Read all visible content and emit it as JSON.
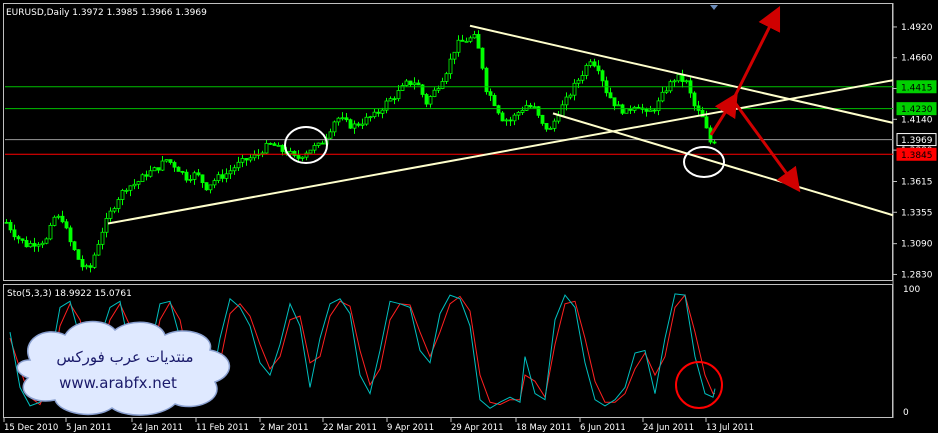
{
  "colors": {
    "background": "#000000",
    "frame": "#c0c0c0",
    "bull_candle": "#00ff00",
    "bear_candle": "#00ff00",
    "trendline": "#ffffcc",
    "hline_green": "#00c000",
    "hline_red": "#ff0000",
    "hline_gray": "#9a9a9a",
    "stoch_main": "#00c0c0",
    "stoch_signal": "#ff2020",
    "arrow": "#d00000",
    "circle_white": "#ffffff",
    "circle_red": "#ff0000",
    "badge_green": "#00d000",
    "badge_red": "#ff0000",
    "watermark_cloud": "#dfe9ff",
    "watermark_text": "#1a1a6a"
  },
  "chart_data": [
    {
      "type": "candlestick",
      "title": "EURUSD,Daily  1.3972 1.3985 1.3966 1.3969",
      "symbol": "EURUSD",
      "timeframe": "Daily",
      "ohlc_label": "1.3972 1.3985 1.3966 1.3969",
      "ylim": [
        1.28,
        1.508
      ],
      "y_ticks": [
        "1.4920",
        "1.4660",
        "1.4400",
        "1.4140",
        "1.3880",
        "1.3615",
        "1.3355",
        "1.3090",
        "1.2830"
      ],
      "y_tick_values": [
        1.492,
        1.466,
        1.44,
        1.414,
        1.388,
        1.3615,
        1.3355,
        1.309,
        1.283
      ],
      "price_badges": [
        {
          "label": "1.4415",
          "value": 1.4415,
          "kind": "green"
        },
        {
          "label": "1.4230",
          "value": 1.423,
          "kind": "green"
        },
        {
          "label": "1.3969",
          "value": 1.3969,
          "kind": "current"
        },
        {
          "label": "1.3845",
          "value": 1.3845,
          "kind": "red"
        }
      ],
      "x_ticks": [
        "15 Dec 2010",
        "5 Jan 2011",
        "24 Jan 2011",
        "11 Feb 2011",
        "2 Mar 2011",
        "22 Mar 2011",
        "9 Apr 2011",
        "29 Apr 2011",
        "18 May 2011",
        "6 Jun 2011",
        "24 Jun 2011",
        "13 Jul 2011"
      ],
      "close_path": [
        [
          0,
          1.327
        ],
        [
          10,
          1.315
        ],
        [
          20,
          1.308
        ],
        [
          30,
          1.31
        ],
        [
          40,
          1.312
        ],
        [
          48,
          1.331
        ],
        [
          56,
          1.33
        ],
        [
          64,
          1.31
        ],
        [
          72,
          1.296
        ],
        [
          78,
          1.287
        ],
        [
          84,
          1.289
        ],
        [
          90,
          1.305
        ],
        [
          96,
          1.32
        ],
        [
          104,
          1.335
        ],
        [
          112,
          1.348
        ],
        [
          120,
          1.357
        ],
        [
          130,
          1.36
        ],
        [
          140,
          1.368
        ],
        [
          150,
          1.372
        ],
        [
          160,
          1.38
        ],
        [
          170,
          1.374
        ],
        [
          180,
          1.365
        ],
        [
          190,
          1.368
        ],
        [
          200,
          1.357
        ],
        [
          210,
          1.364
        ],
        [
          220,
          1.368
        ],
        [
          230,
          1.375
        ],
        [
          240,
          1.38
        ],
        [
          250,
          1.383
        ],
        [
          258,
          1.39
        ],
        [
          266,
          1.393
        ],
        [
          274,
          1.388
        ],
        [
          282,
          1.386
        ],
        [
          290,
          1.38
        ],
        [
          298,
          1.386
        ],
        [
          306,
          1.39
        ],
        [
          314,
          1.392
        ],
        [
          322,
          1.403
        ],
        [
          330,
          1.416
        ],
        [
          338,
          1.412
        ],
        [
          346,
          1.408
        ],
        [
          354,
          1.411
        ],
        [
          362,
          1.415
        ],
        [
          370,
          1.418
        ],
        [
          380,
          1.428
        ],
        [
          390,
          1.435
        ],
        [
          400,
          1.444
        ],
        [
          410,
          1.446
        ],
        [
          420,
          1.428
        ],
        [
          430,
          1.44
        ],
        [
          440,
          1.455
        ],
        [
          450,
          1.477
        ],
        [
          460,
          1.481
        ],
        [
          468,
          1.483
        ],
        [
          474,
          1.468
        ],
        [
          480,
          1.44
        ],
        [
          488,
          1.428
        ],
        [
          496,
          1.415
        ],
        [
          504,
          1.413
        ],
        [
          512,
          1.42
        ],
        [
          520,
          1.426
        ],
        [
          528,
          1.423
        ],
        [
          536,
          1.409
        ],
        [
          544,
          1.405
        ],
        [
          552,
          1.42
        ],
        [
          560,
          1.43
        ],
        [
          568,
          1.442
        ],
        [
          576,
          1.453
        ],
        [
          584,
          1.465
        ],
        [
          592,
          1.458
        ],
        [
          600,
          1.438
        ],
        [
          610,
          1.425
        ],
        [
          620,
          1.42
        ],
        [
          630,
          1.428
        ],
        [
          640,
          1.418
        ],
        [
          650,
          1.425
        ],
        [
          660,
          1.44
        ],
        [
          670,
          1.45
        ],
        [
          680,
          1.445
        ],
        [
          688,
          1.425
        ],
        [
          696,
          1.415
        ],
        [
          704,
          1.395
        ],
        [
          710,
          1.3969
        ]
      ]
    },
    {
      "type": "line",
      "title": "Sto(5,3,3) 18.9922 15.0761",
      "series": [
        {
          "name": "main",
          "value_label": "18.9922"
        },
        {
          "name": "signal",
          "value_label": "15.0761"
        }
      ],
      "ylim": [
        0,
        100
      ],
      "y_ticks": [
        "100",
        "0"
      ],
      "main_path": [
        [
          5,
          65
        ],
        [
          15,
          20
        ],
        [
          25,
          5
        ],
        [
          35,
          8
        ],
        [
          45,
          40
        ],
        [
          55,
          85
        ],
        [
          65,
          90
        ],
        [
          75,
          60
        ],
        [
          85,
          25
        ],
        [
          95,
          60
        ],
        [
          105,
          85
        ],
        [
          115,
          90
        ],
        [
          125,
          50
        ],
        [
          135,
          15
        ],
        [
          145,
          50
        ],
        [
          155,
          88
        ],
        [
          165,
          90
        ],
        [
          175,
          60
        ],
        [
          185,
          20
        ],
        [
          195,
          10
        ],
        [
          205,
          15
        ],
        [
          215,
          60
        ],
        [
          225,
          92
        ],
        [
          235,
          85
        ],
        [
          245,
          70
        ],
        [
          255,
          40
        ],
        [
          265,
          30
        ],
        [
          275,
          55
        ],
        [
          285,
          88
        ],
        [
          295,
          70
        ],
        [
          305,
          20
        ],
        [
          315,
          60
        ],
        [
          325,
          88
        ],
        [
          335,
          92
        ],
        [
          345,
          80
        ],
        [
          355,
          30
        ],
        [
          365,
          15
        ],
        [
          375,
          50
        ],
        [
          385,
          90
        ],
        [
          395,
          88
        ],
        [
          405,
          85
        ],
        [
          415,
          50
        ],
        [
          425,
          40
        ],
        [
          435,
          80
        ],
        [
          445,
          95
        ],
        [
          455,
          92
        ],
        [
          465,
          70
        ],
        [
          475,
          10
        ],
        [
          485,
          3
        ],
        [
          495,
          8
        ],
        [
          505,
          12
        ],
        [
          515,
          8
        ],
        [
          520,
          45
        ],
        [
          530,
          15
        ],
        [
          540,
          10
        ],
        [
          550,
          75
        ],
        [
          560,
          95
        ],
        [
          570,
          85
        ],
        [
          580,
          40
        ],
        [
          590,
          10
        ],
        [
          600,
          5
        ],
        [
          610,
          10
        ],
        [
          620,
          20
        ],
        [
          630,
          48
        ],
        [
          640,
          50
        ],
        [
          650,
          15
        ],
        [
          660,
          60
        ],
        [
          670,
          96
        ],
        [
          680,
          95
        ],
        [
          690,
          45
        ],
        [
          700,
          15
        ],
        [
          708,
          12
        ],
        [
          710,
          19
        ]
      ],
      "signal_path": [
        [
          5,
          60
        ],
        [
          15,
          35
        ],
        [
          25,
          12
        ],
        [
          35,
          6
        ],
        [
          45,
          25
        ],
        [
          55,
          70
        ],
        [
          65,
          88
        ],
        [
          75,
          75
        ],
        [
          85,
          40
        ],
        [
          95,
          45
        ],
        [
          105,
          75
        ],
        [
          115,
          88
        ],
        [
          125,
          70
        ],
        [
          135,
          30
        ],
        [
          145,
          35
        ],
        [
          155,
          75
        ],
        [
          165,
          89
        ],
        [
          175,
          75
        ],
        [
          185,
          35
        ],
        [
          195,
          15
        ],
        [
          205,
          12
        ],
        [
          215,
          40
        ],
        [
          225,
          80
        ],
        [
          235,
          88
        ],
        [
          245,
          78
        ],
        [
          255,
          55
        ],
        [
          265,
          35
        ],
        [
          275,
          45
        ],
        [
          285,
          75
        ],
        [
          295,
          78
        ],
        [
          305,
          40
        ],
        [
          315,
          45
        ],
        [
          325,
          78
        ],
        [
          335,
          90
        ],
        [
          345,
          86
        ],
        [
          355,
          50
        ],
        [
          365,
          22
        ],
        [
          375,
          35
        ],
        [
          385,
          75
        ],
        [
          395,
          88
        ],
        [
          405,
          87
        ],
        [
          415,
          65
        ],
        [
          425,
          45
        ],
        [
          435,
          65
        ],
        [
          445,
          88
        ],
        [
          455,
          94
        ],
        [
          465,
          82
        ],
        [
          475,
          30
        ],
        [
          485,
          8
        ],
        [
          495,
          6
        ],
        [
          505,
          10
        ],
        [
          515,
          10
        ],
        [
          520,
          30
        ],
        [
          530,
          25
        ],
        [
          540,
          12
        ],
        [
          550,
          55
        ],
        [
          560,
          88
        ],
        [
          570,
          90
        ],
        [
          580,
          60
        ],
        [
          590,
          25
        ],
        [
          600,
          8
        ],
        [
          610,
          8
        ],
        [
          620,
          15
        ],
        [
          630,
          35
        ],
        [
          640,
          48
        ],
        [
          650,
          30
        ],
        [
          660,
          45
        ],
        [
          670,
          85
        ],
        [
          680,
          95
        ],
        [
          690,
          65
        ],
        [
          700,
          30
        ],
        [
          708,
          15
        ],
        [
          710,
          15
        ]
      ]
    }
  ],
  "watermark": {
    "arabic": "منتديات عرب فوركس",
    "url": "www.arabfx.net"
  }
}
